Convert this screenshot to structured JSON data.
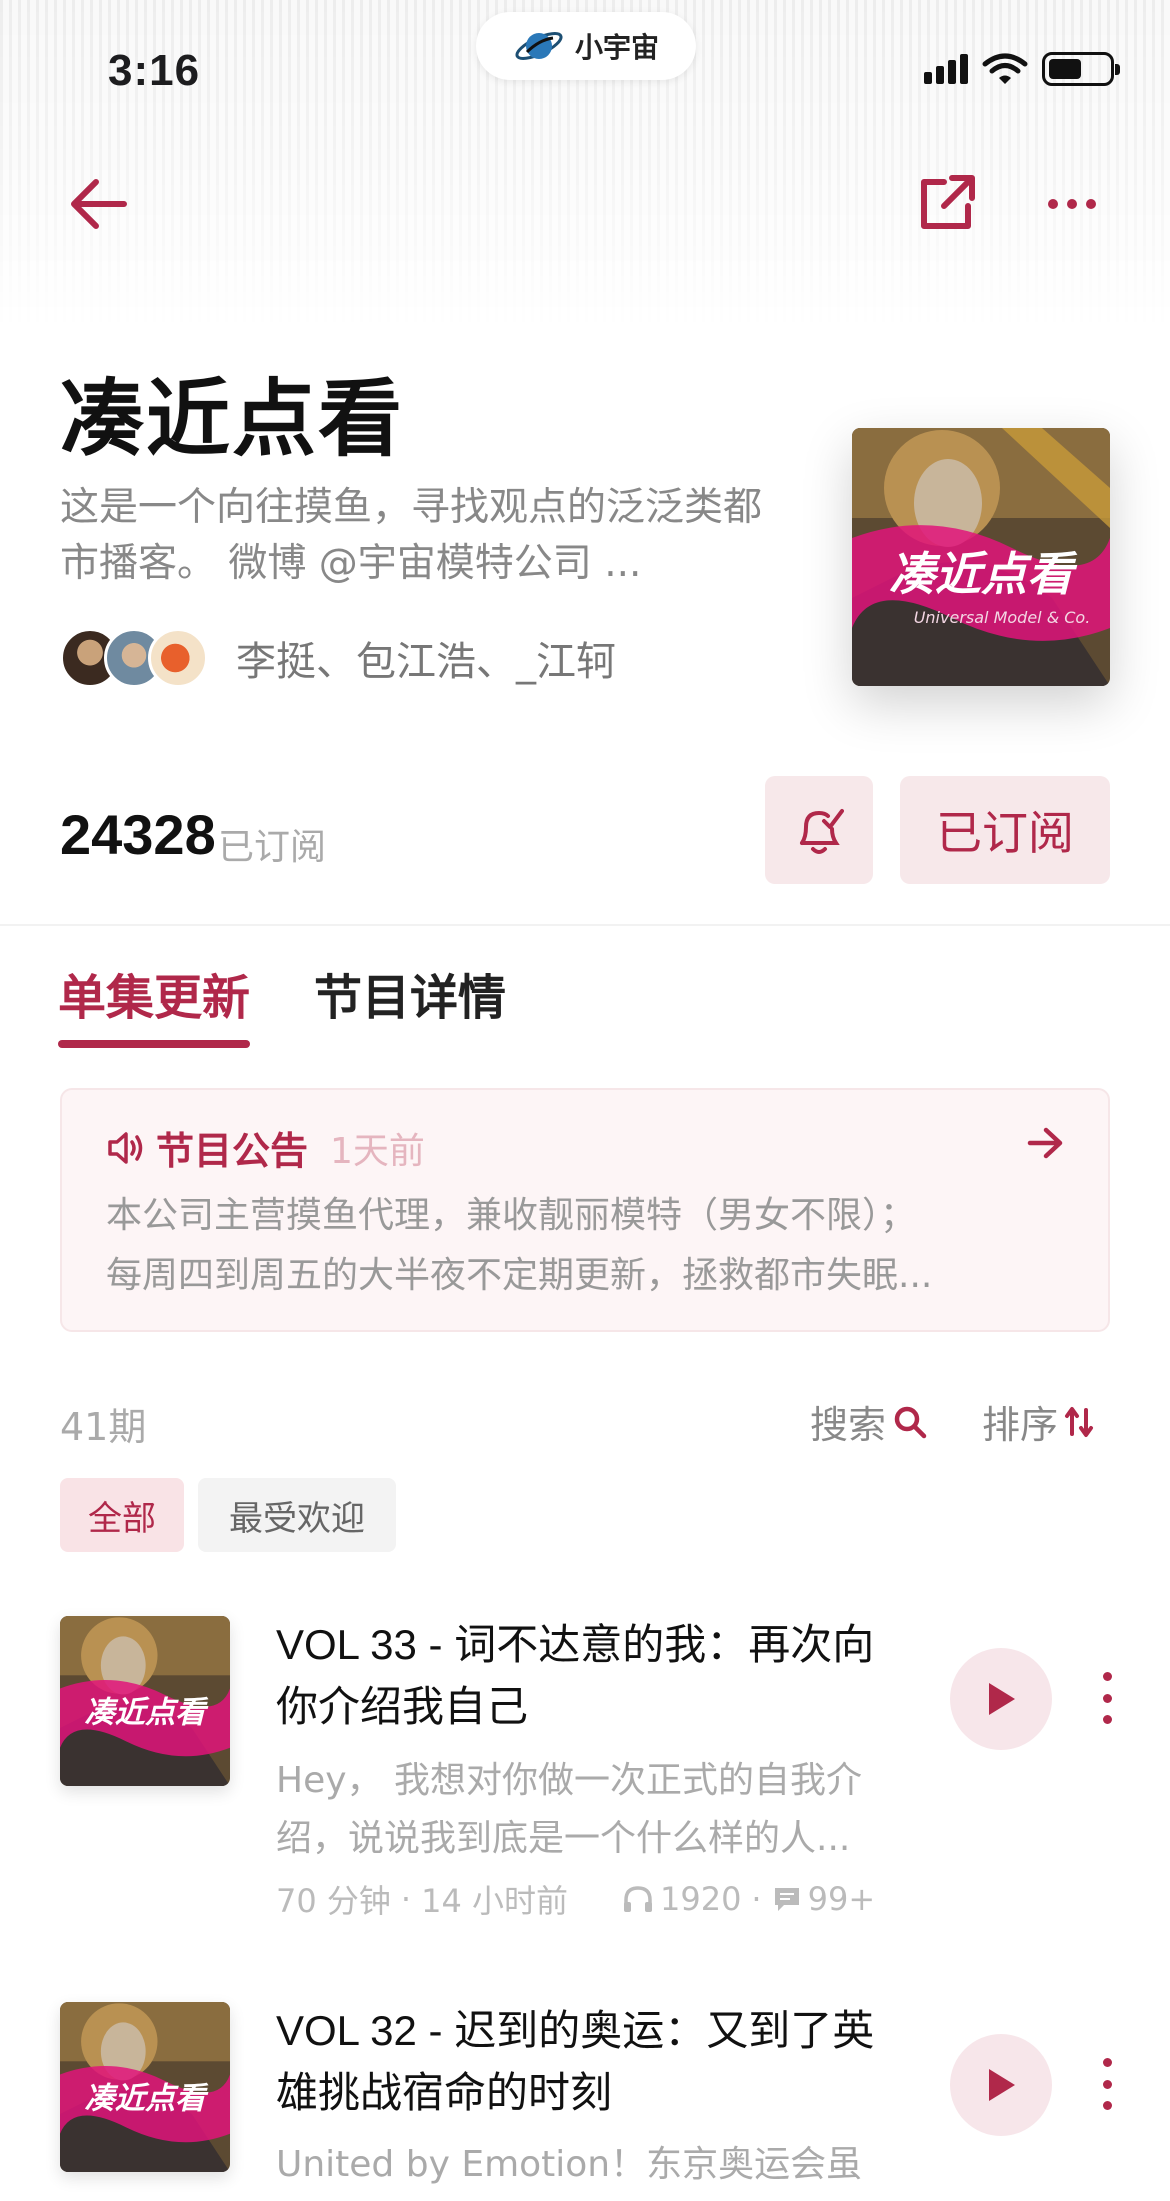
{
  "status_bar": {
    "time": "3:16",
    "app_pill": "小宇宙"
  },
  "podcast": {
    "title": "凑近点看",
    "description": "这是一个向往摸鱼，寻找观点的泛泛类都市播客。 微博 @宇宙模特公司 ...",
    "hosts": "李挺、包江浩、_江轲",
    "cover_text": "凑近点看",
    "cover_subtext": "Universal Model & Co.",
    "subscribers": "24328",
    "subscribers_label": "已订阅",
    "subscribe_button": "已订阅"
  },
  "tabs": [
    {
      "label": "单集更新",
      "active": true
    },
    {
      "label": "节目详情",
      "active": false
    }
  ],
  "notice": {
    "title": "节目公告",
    "time": "1天前",
    "line1": "本公司主营摸鱼代理，兼收靓丽模特（男女不限）；",
    "line2": "每周四到周五的大半夜不定期更新，拯救都市失眠..."
  },
  "episode_list": {
    "count": "41期",
    "search_label": "搜索",
    "sort_label": "排序",
    "filters": [
      "全部",
      "最受欢迎"
    ]
  },
  "episodes": [
    {
      "title": "VOL 33 - 词不达意的我：再次向你介绍我自己",
      "description": "Hey， 我想对你做一次正式的自我介绍，说说我到底是一个什么样的人...",
      "duration": "70 分钟",
      "published": "14 小时前",
      "plays": "1920",
      "comments": "99+"
    },
    {
      "title": "VOL 32 - 迟到的奥运：又到了英雄挑战宿命的时刻",
      "description": "United by Emotion！东京奥运会虽"
    }
  ],
  "colors": {
    "accent": "#b0284a",
    "accent_light": "#f7e8ea",
    "cover_pink": "#e0147a"
  }
}
